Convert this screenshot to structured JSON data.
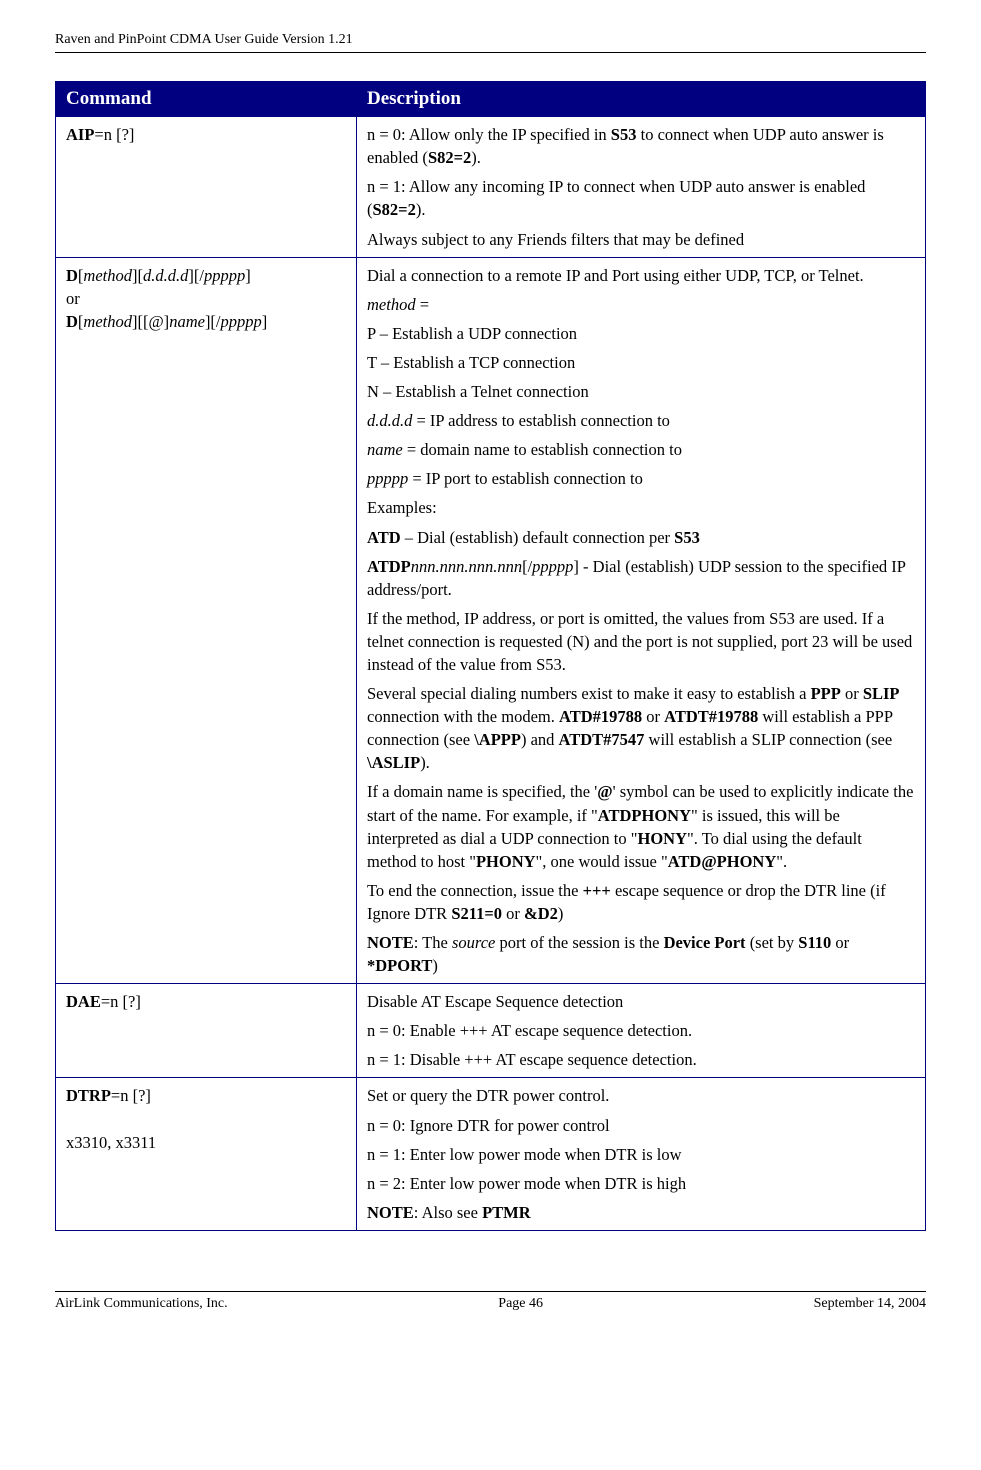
{
  "header": "Raven and PinPoint CDMA User Guide Version 1.21",
  "table": {
    "headers": {
      "cmd": "Command",
      "desc": "Description"
    },
    "rows": [
      {
        "cmd_bold": "AIP",
        "cmd_rest": "=n [?]",
        "desc": [
          {
            "parts": [
              {
                "t": "n = 0: Allow only the IP specified in "
              },
              {
                "b": "S53"
              },
              {
                "t": " to connect when UDP auto answer is enabled ("
              },
              {
                "b": "S82=2"
              },
              {
                "t": ")."
              }
            ]
          },
          {
            "parts": [
              {
                "t": "n = 1: Allow any incoming IP to connect when UDP auto answer is enabled ("
              },
              {
                "b": "S82=2"
              },
              {
                "t": ")."
              }
            ]
          },
          {
            "parts": [
              {
                "t": "Always subject to any Friends filters that may be defined"
              }
            ]
          }
        ]
      },
      {
        "cmd_complex": [
          {
            "b": "D"
          },
          {
            "t": "["
          },
          {
            "i": "method"
          },
          {
            "t": "]["
          },
          {
            "i": "d.d.d.d"
          },
          {
            "t": "][/"
          },
          {
            "i": "ppppp"
          },
          {
            "t": "]"
          },
          {
            "br": true
          },
          {
            "t": "or"
          },
          {
            "br": true
          },
          {
            "b": "D"
          },
          {
            "t": "["
          },
          {
            "i": "method"
          },
          {
            "t": "][[@]"
          },
          {
            "i": "name"
          },
          {
            "t": "][/"
          },
          {
            "i": "ppppp"
          },
          {
            "t": "]"
          }
        ],
        "desc": [
          {
            "parts": [
              {
                "t": "Dial a connection to a remote IP and Port using either UDP, TCP, or Telnet."
              }
            ]
          },
          {
            "parts": [
              {
                "i": "method"
              },
              {
                "t": " ="
              }
            ]
          },
          {
            "parts": [
              {
                "t": "P – Establish a UDP connection"
              }
            ]
          },
          {
            "parts": [
              {
                "t": "T – Establish a TCP connection"
              }
            ]
          },
          {
            "parts": [
              {
                "t": "N – Establish a Telnet connection"
              }
            ]
          },
          {
            "parts": [
              {
                "i": "d.d.d.d"
              },
              {
                "t": " = IP address to establish connection to"
              }
            ]
          },
          {
            "parts": [
              {
                "i": "name"
              },
              {
                "t": " = domain name to establish connection to"
              }
            ]
          },
          {
            "parts": [
              {
                "i": "ppppp"
              },
              {
                "t": " = IP port to establish connection to"
              }
            ]
          },
          {
            "parts": [
              {
                "t": "Examples:"
              }
            ]
          },
          {
            "parts": [
              {
                "b": "ATD"
              },
              {
                "t": " – Dial (establish) default connection per "
              },
              {
                "b": "S53"
              }
            ]
          },
          {
            "parts": [
              {
                "b": "ATDP"
              },
              {
                "i": "nnn.nnn.nnn.nnn"
              },
              {
                "t": "[/"
              },
              {
                "i": "ppppp"
              },
              {
                "t": "] - Dial (establish) UDP session to the specified IP address/port."
              }
            ]
          },
          {
            "parts": [
              {
                "t": "If the method, IP address, or port is omitted, the values from S53 are used. If a telnet connection is requested (N) and the port is not supplied, port 23 will be used instead of the value from S53."
              }
            ]
          },
          {
            "parts": [
              {
                "t": "Several special dialing numbers exist to make it easy to establish a "
              },
              {
                "b": "PPP"
              },
              {
                "t": " or "
              },
              {
                "b": "SLIP"
              },
              {
                "t": " connection with the modem. "
              },
              {
                "b": "ATD#19788"
              },
              {
                "t": " or "
              },
              {
                "b": "ATDT#19788"
              },
              {
                "t": " will establish a PPP connection (see "
              },
              {
                "b": "\\APPP"
              },
              {
                "t": ") and "
              },
              {
                "b": "ATDT#7547"
              },
              {
                "t": " will establish a SLIP connection (see "
              },
              {
                "b": "\\ASLIP"
              },
              {
                "t": ")."
              }
            ]
          },
          {
            "parts": [
              {
                "t": "If a domain name is specified, the '"
              },
              {
                "b": "@"
              },
              {
                "t": "' symbol can be used to explicitly indicate the start of the name. For example, if \""
              },
              {
                "b": "ATDPHONY"
              },
              {
                "t": "\" is issued, this will be interpreted as dial a UDP connection to \""
              },
              {
                "b": "HONY"
              },
              {
                "t": "\". To dial using the default method to host \""
              },
              {
                "b": "PHONY"
              },
              {
                "t": "\", one would issue \""
              },
              {
                "b": "ATD@PHONY"
              },
              {
                "t": "\"."
              }
            ]
          },
          {
            "parts": [
              {
                "t": "To end the connection, issue the "
              },
              {
                "b": "+++"
              },
              {
                "t": " escape sequence or drop the DTR line (if Ignore DTR "
              },
              {
                "b": "S211=0"
              },
              {
                "t": " or "
              },
              {
                "b": "&D2"
              },
              {
                "t": ")"
              }
            ]
          },
          {
            "parts": [
              {
                "b": "NOTE"
              },
              {
                "t": ": The "
              },
              {
                "i": "source"
              },
              {
                "t": " port of the session is the "
              },
              {
                "b": "Device Port"
              },
              {
                "t": " (set by "
              },
              {
                "b": "S110"
              },
              {
                "t": " or "
              },
              {
                "b": "*DPORT"
              },
              {
                "t": ")"
              }
            ]
          }
        ]
      },
      {
        "cmd_bold": "DAE",
        "cmd_rest": "=n [?]",
        "desc": [
          {
            "parts": [
              {
                "t": "Disable AT Escape Sequence detection"
              }
            ]
          },
          {
            "parts": [
              {
                "t": "n = 0: Enable +++ AT escape sequence detection."
              }
            ]
          },
          {
            "parts": [
              {
                "t": "n = 1: Disable +++ AT escape sequence detection."
              }
            ]
          }
        ]
      },
      {
        "cmd_complex": [
          {
            "b": "DTRP"
          },
          {
            "t": "=n [?]"
          },
          {
            "br": true
          },
          {
            "br": true
          },
          {
            "t": "x3310, x3311"
          }
        ],
        "desc": [
          {
            "parts": [
              {
                "t": "Set or query the DTR power control."
              }
            ]
          },
          {
            "parts": [
              {
                "t": "n = 0: Ignore DTR for power control"
              }
            ]
          },
          {
            "parts": [
              {
                "t": "n = 1: Enter low power mode when DTR is low"
              }
            ]
          },
          {
            "parts": [
              {
                "t": "n = 2: Enter low power mode when DTR is high"
              }
            ]
          },
          {
            "parts": [
              {
                "b": "NOTE"
              },
              {
                "t": ": Also see "
              },
              {
                "b": "PTMR"
              }
            ]
          }
        ]
      }
    ]
  },
  "footer": {
    "left": "AirLink Communications, Inc.",
    "center": "Page 46",
    "right": "September 14, 2004"
  }
}
